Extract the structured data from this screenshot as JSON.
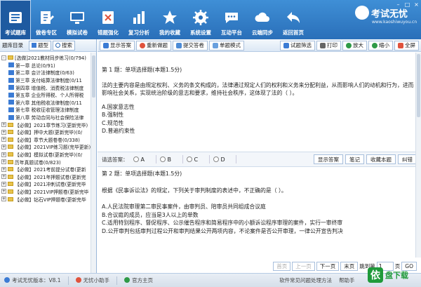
{
  "toolbar": {
    "items": [
      {
        "label": "考试题库",
        "icon": "book-stack-icon",
        "active": true
      },
      {
        "label": "做卷专区",
        "icon": "paper-pen-icon"
      },
      {
        "label": "模拟试卷",
        "icon": "monitor-icon"
      },
      {
        "label": "错题强化",
        "icon": "error-list-icon"
      },
      {
        "label": "复习分析",
        "icon": "bar-chart-icon"
      },
      {
        "label": "我的收藏",
        "icon": "star-icon"
      },
      {
        "label": "系统设置",
        "icon": "gear-icon"
      },
      {
        "label": "互动平台",
        "icon": "chat-icon"
      },
      {
        "label": "云端同步",
        "icon": "cloud-icon"
      },
      {
        "label": "返回首页",
        "icon": "return-arrow-icon"
      }
    ],
    "brand": {
      "name": "考试无忧",
      "sub": "www.kaoshiwuyou.cn"
    },
    "accent": "#2a6fb9"
  },
  "left_panel": {
    "title": "题库目录",
    "btn_tree": "题型",
    "btn_search": "搜索",
    "tree": [
      {
        "level": 0,
        "expander": "-",
        "text": "[选做]2021教材同步练习(0/794)"
      },
      {
        "level": 1,
        "text": "第一章 总论(0/91)"
      },
      {
        "level": 1,
        "text": "第二章 会计法律制度(0/63)"
      },
      {
        "level": 1,
        "text": "第三章 支付结算法律制度(0/11"
      },
      {
        "level": 1,
        "text": "第四章 增值税、消费税法律制度"
      },
      {
        "level": 1,
        "text": "第五章 企业所得税、个人所得税"
      },
      {
        "level": 1,
        "text": "第六章 其他税收法律制度(0/11"
      },
      {
        "level": 1,
        "text": "第七章 税收征收管理法律制度"
      },
      {
        "level": 1,
        "text": "第八章 劳动合同与社会保险法律"
      },
      {
        "level": 0,
        "expander": "+",
        "text": "【必做】2021章节练习(更新完毕)"
      },
      {
        "level": 0,
        "expander": "+",
        "text": "【必做】押中大题(更新完毕)(0/"
      },
      {
        "level": 0,
        "expander": "+",
        "text": "【必做】章节大题卷卷(0/338)"
      },
      {
        "level": 0,
        "expander": "+",
        "text": "【必做】2021VIP练习题(完毕更新)"
      },
      {
        "level": 0,
        "expander": "+",
        "text": "【必做】模拟试卷(更新完毕)(0/"
      },
      {
        "level": 0,
        "expander": "+",
        "text": "历年真题试卷(0/823)"
      },
      {
        "level": 0,
        "expander": "+",
        "text": "【必做】2021考前提分试卷(更新"
      },
      {
        "level": 0,
        "expander": "+",
        "text": "【必做】2021年押题试卷(更新完"
      },
      {
        "level": 0,
        "expander": "+",
        "text": "【必做】2021冲刺试卷(更新完毕"
      },
      {
        "level": 0,
        "expander": "+",
        "text": "【必做】2021VIP押题卷(更新完毕"
      },
      {
        "level": 0,
        "expander": "+",
        "text": "【必做】钻石VIP押题卷(更新完毕"
      }
    ]
  },
  "main_toolbar": {
    "show_answer": "显示答案",
    "redo": "重新做题",
    "submit": "提交答卷",
    "single_mode": "单题模式",
    "filter": "试题筛选",
    "print": "打印",
    "zoom_in": "放大",
    "zoom_out": "缩小",
    "fullscreen": "全屏"
  },
  "questions": [
    {
      "head": "第 1 题：单项选择题(本题1.5分)",
      "text": "法的主要内容是由规定权利、义务的条文构成的，法律通过规定人们的权利和义务来分配利益，从而影响人们的动机和行为，进而影响社会关系，实现统治阶级的意志和要求，维持社会秩序，这体现了法的（ ）。",
      "options": [
        "A.国家意志性",
        "B.强制性",
        "C.规范性",
        "D.普遍约束性"
      ]
    },
    {
      "head": "第 2 题：单项选择题(本题1.5分)",
      "text": "根据《民事诉讼法》的规定，下列关于审判制度的表述中，不正确的是（ ）。",
      "options": [
        "A.人民法院审理第二审民事案件，由审判员、陪审员共同组成合议庭",
        "B.合议庭的成员，应当是3人以上的单数",
        "C.适用特别程序、督促程序、公示催告程序和简易程序中的小额诉讼程序审理的案件，实行一审终审",
        "D.公开审判包括审判过程公开和审判结果公开两项内容，不论案件是否公开审理，一律公开宣告判决"
      ]
    }
  ],
  "answer_bar": {
    "label": "请选答案：",
    "choices": [
      "A",
      "B",
      "C",
      "D"
    ],
    "btn_show": "显示答案",
    "btn_note": "笔记",
    "btn_fav": "收藏本题",
    "btn_error": "纠错"
  },
  "pager": {
    "first": "首页",
    "prev": "上一页",
    "next": "下一页",
    "last": "末页",
    "jump_label": "跳到第",
    "page_value": "1",
    "page_unit": "页",
    "go": "GO"
  },
  "status": {
    "version": "考试无忧版本：V8.1",
    "helper": "无忧小助手",
    "home": "官方主页",
    "faq": "软件常见问题处理方法",
    "assist": "帮助手"
  },
  "watermark": {
    "logo": "依",
    "text": "盘下载"
  }
}
